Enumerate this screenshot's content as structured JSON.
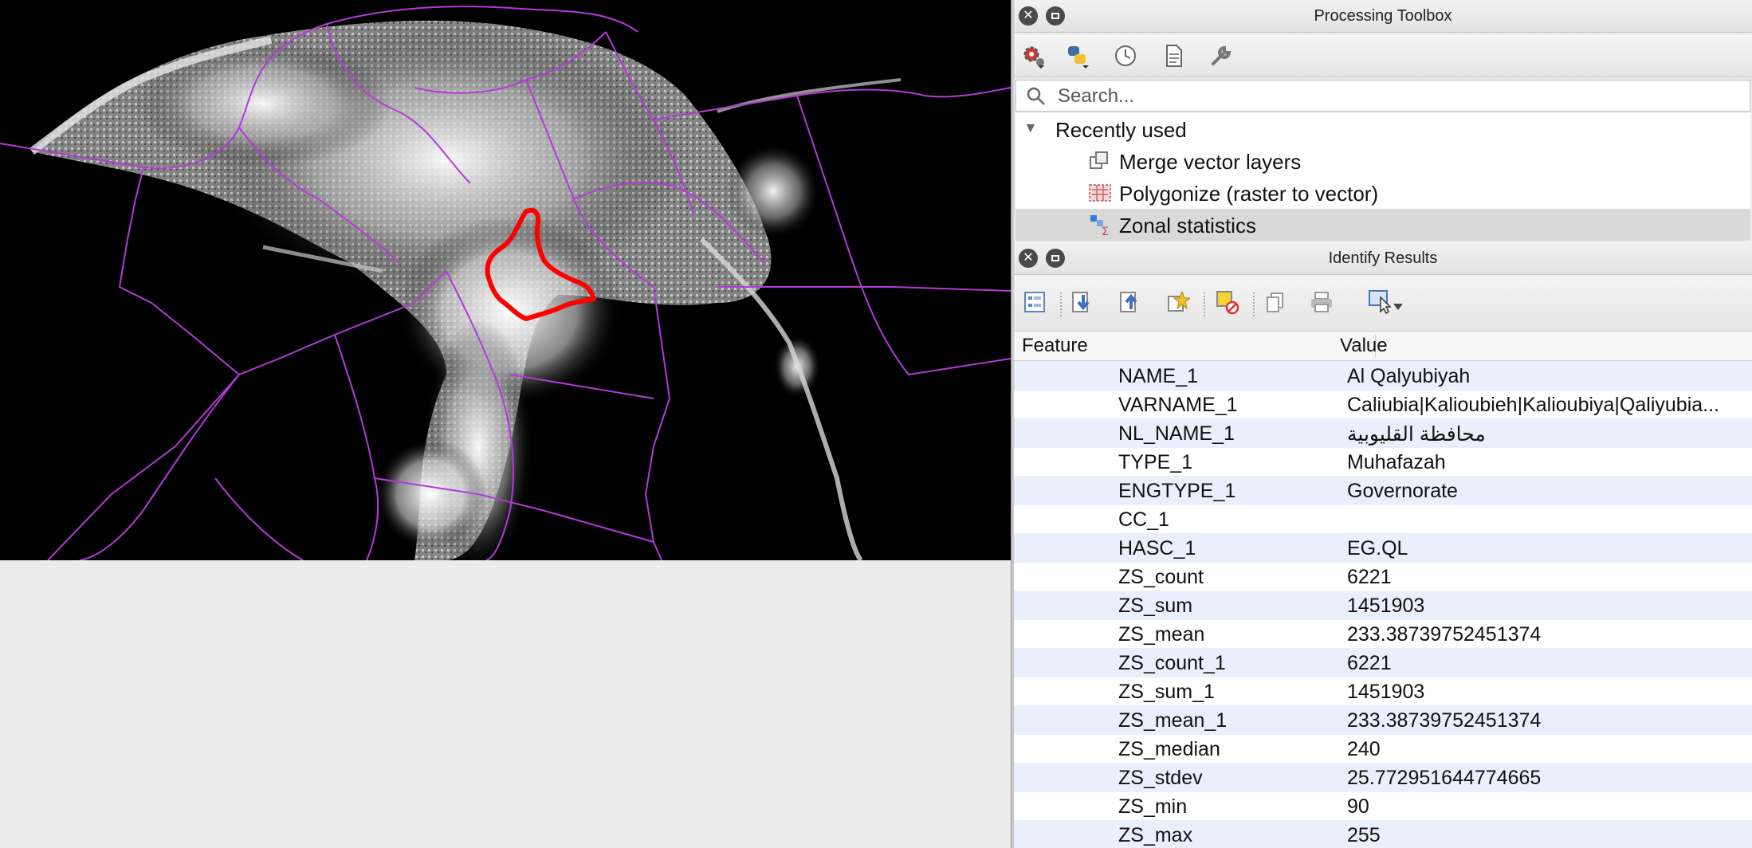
{
  "processing_toolbox": {
    "title": "Processing Toolbox",
    "toolbar_icons": [
      "models-gear-icon",
      "python-icon",
      "history-clock-icon",
      "results-document-icon",
      "options-wrench-icon"
    ],
    "search_placeholder": "Search...",
    "tree": {
      "group": "Recently used",
      "items": [
        {
          "label": "Merge vector layers",
          "icon": "merge-icon"
        },
        {
          "label": "Polygonize (raster to vector)",
          "icon": "polygonize-icon"
        },
        {
          "label": "Zonal statistics",
          "icon": "zonal-stats-icon",
          "selected": true
        }
      ]
    }
  },
  "identify_results": {
    "title": "Identify Results",
    "toolbar_icons": [
      "expand-tree-icon",
      "collapse-down-icon",
      "collapse-up-icon",
      "highlight-star-icon",
      "clear-highlight-icon",
      "copy-icon",
      "print-icon",
      "select-mode-icon"
    ],
    "columns": {
      "feature": "Feature",
      "value": "Value"
    },
    "rows": [
      {
        "key": "NAME_1",
        "value": "Al Qalyubiyah"
      },
      {
        "key": "VARNAME_1",
        "value": "Caliubia|Kalioubieh|Kalioubiya|Qaliyubia..."
      },
      {
        "key": "NL_NAME_1",
        "value": "محافظة القليوبية"
      },
      {
        "key": "TYPE_1",
        "value": "Muhafazah"
      },
      {
        "key": "ENGTYPE_1",
        "value": "Governorate"
      },
      {
        "key": "CC_1",
        "value": ""
      },
      {
        "key": "HASC_1",
        "value": "EG.QL"
      },
      {
        "key": "ZS_count",
        "value": "6221"
      },
      {
        "key": "ZS_sum",
        "value": "1451903"
      },
      {
        "key": "ZS_mean",
        "value": "233.38739752451374"
      },
      {
        "key": "ZS_count_1",
        "value": "6221"
      },
      {
        "key": "ZS_sum_1",
        "value": "1451903"
      },
      {
        "key": "ZS_mean_1",
        "value": "233.38739752451374"
      },
      {
        "key": "ZS_median",
        "value": "240"
      },
      {
        "key": "ZS_stdev",
        "value": "25.772951644774665"
      },
      {
        "key": "ZS_min",
        "value": "90"
      },
      {
        "key": "ZS_max",
        "value": "255"
      }
    ]
  },
  "colors": {
    "boundary": "#b43ad6",
    "selected_boundary": "#ff0000",
    "map_background": "#000000",
    "row_alt": "#e9effb"
  }
}
